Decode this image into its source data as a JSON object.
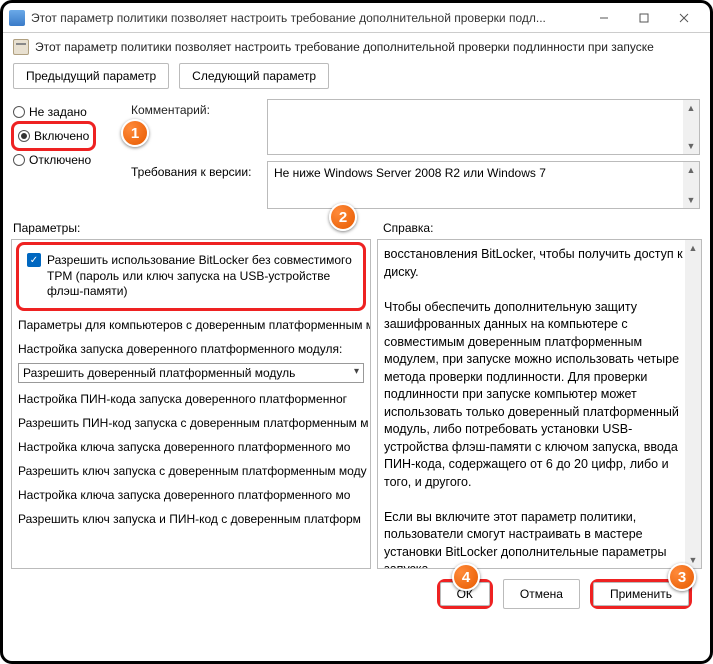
{
  "window": {
    "title": "Этот параметр политики позволяет настроить требование дополнительной проверки подл..."
  },
  "description": "Этот параметр политики позволяет настроить требование дополнительной проверки подлинности при запуске",
  "nav": {
    "prev": "Предыдущий параметр",
    "next": "Следующий параметр"
  },
  "state": {
    "not_configured": "Не задано",
    "enabled": "Включено",
    "disabled": "Отключено"
  },
  "comment_label": "Комментарий:",
  "version_label": "Требования к версии:",
  "version_value": "Не ниже Windows Server 2008 R2 или Windows 7",
  "params_label": "Параметры:",
  "help_label": "Справка:",
  "options": {
    "allow_no_tpm": "Разрешить использование BitLocker без совместимого TPM (пароль или ключ запуска на USB-устройстве флэш-памяти)",
    "lines": [
      "Параметры для компьютеров с доверенным платформенным м",
      "Настройка запуска доверенного платформенного модуля:",
      "Настройка ПИН-кода запуска доверенного платформенног",
      "Разрешить ПИН-код запуска с доверенным платформенным м",
      "Настройка ключа запуска доверенного платформенного мо",
      "Разрешить ключ запуска с доверенным платформенным моду",
      "Настройка ключа запуска доверенного платформенного мо",
      "Разрешить ключ запуска и ПИН-код с доверенным платформ"
    ],
    "select_value": "Разрешить доверенный платформенный модуль"
  },
  "help_text_1": "восстановления BitLocker, чтобы получить доступ к диску.",
  "help_text_2": "Чтобы обеспечить дополнительную защиту зашифрованных данных на компьютере с совместимым доверенным платформенным модулем, при запуске можно использовать четыре метода проверки подлинности. Для проверки подлинности при запуске компьютер может использовать только доверенный платформенный модуль, либо потребовать установки USB-устройства флэш-памяти с ключом запуска, ввода ПИН-кода, содержащего от 6 до 20 цифр, либо и того, и другого.",
  "help_text_3": "Если вы включите этот параметр политики, пользователи смогут настраивать в мастере установки BitLocker дополнительные параметры запуска.",
  "footer": {
    "ok": "ОК",
    "cancel": "Отмена",
    "apply": "Применить"
  }
}
